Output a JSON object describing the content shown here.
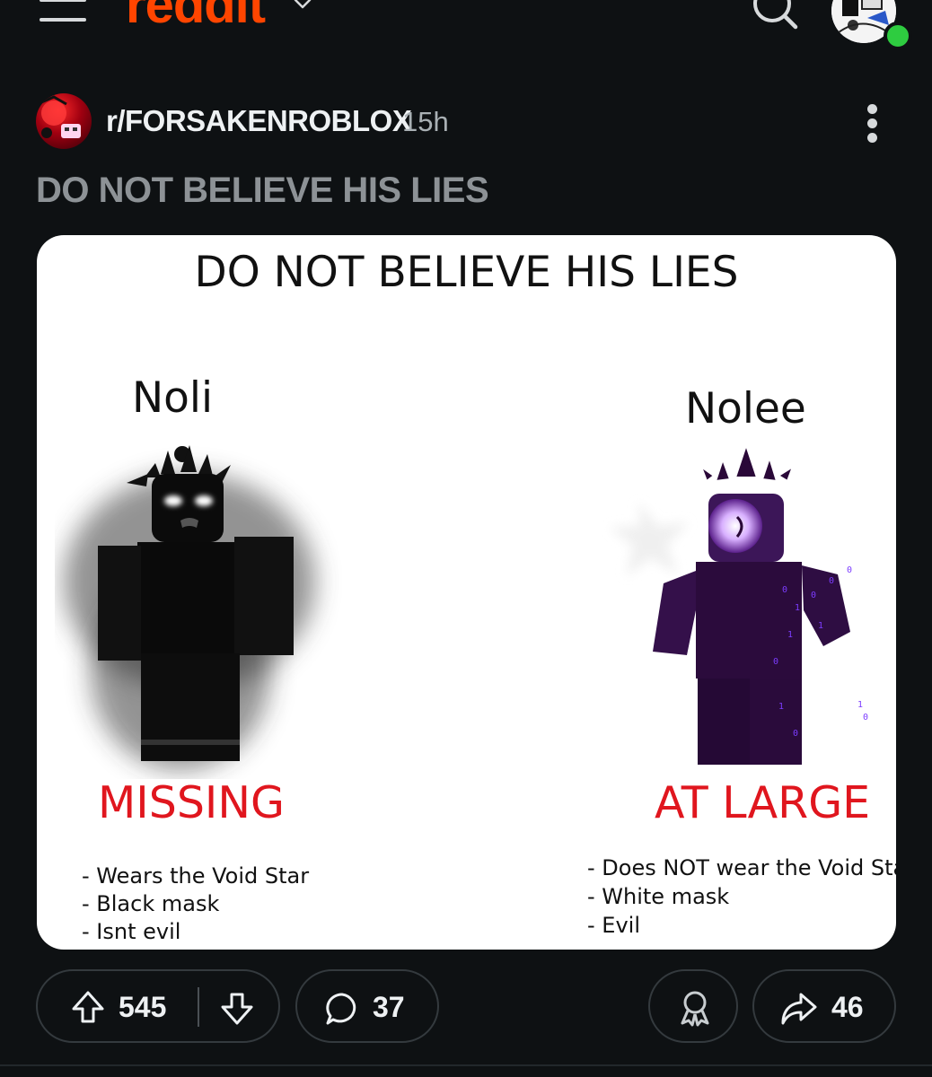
{
  "header": {
    "logo_text": "reddit",
    "icons": [
      "menu-icon",
      "chevron-down-icon",
      "search-icon",
      "avatar"
    ]
  },
  "post": {
    "subreddit": "r/FORSAKENROBLOX",
    "time": "15h",
    "title": "DO NOT BELIEVE HIS LIES"
  },
  "meme": {
    "title": "DO NOT BELIEVE HIS LIES",
    "left": {
      "name": "Noli",
      "status": "MISSING",
      "traits": [
        "- Wears the Void Star",
        "- Black mask",
        "- Isnt evil"
      ]
    },
    "right": {
      "name": "Nolee",
      "status": "AT LARGE",
      "traits": [
        "- Does NOT wear the Void Star",
        "- White mask",
        "- Evil"
      ]
    }
  },
  "actions": {
    "upvotes": "545",
    "comments": "37",
    "shares": "46"
  },
  "colors": {
    "background": "#0e1113",
    "brand": "#ff4500",
    "status_red": "#e0161e",
    "online": "#2ecc40"
  }
}
